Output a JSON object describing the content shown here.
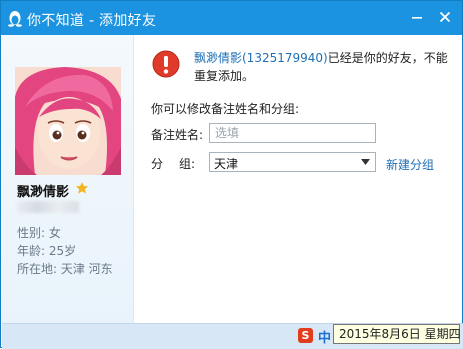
{
  "window": {
    "title": "你不知道 - 添加好友",
    "logo_icon": "qq-penguin-icon",
    "minimize_icon": "minimize-icon",
    "close_icon": "close-icon",
    "title_bar_color": "#1b93e0"
  },
  "profile": {
    "avatar_icon": "cartoon-girl-avatar",
    "nickname": "飘渺倩影",
    "badge_icon": "star-icon",
    "gender": "性别: 女",
    "age": "年龄: 25岁",
    "location": "所在地: 天津  河东"
  },
  "message": {
    "icon": "error-icon",
    "name_link": "飘渺倩影(1325179940)",
    "text": "已经是你的好友，不能重复添加。"
  },
  "form": {
    "prompt": "你可以修改备注姓名和分组:",
    "remark_label": "备注姓名:",
    "remark_placeholder": "选填",
    "group_label_1": "分",
    "group_label_2": "组:",
    "group_value": "天津",
    "new_group_link": "新建分组"
  },
  "taskbar": {
    "ime_icon": "sogou-ime-icon",
    "ime_s": "S",
    "ime_mode": "中",
    "tooltip": "2015年8月6日 星期四"
  },
  "colors": {
    "link": "#1f6fb6",
    "error": "#e03a2a",
    "star": "#f2b51d"
  }
}
